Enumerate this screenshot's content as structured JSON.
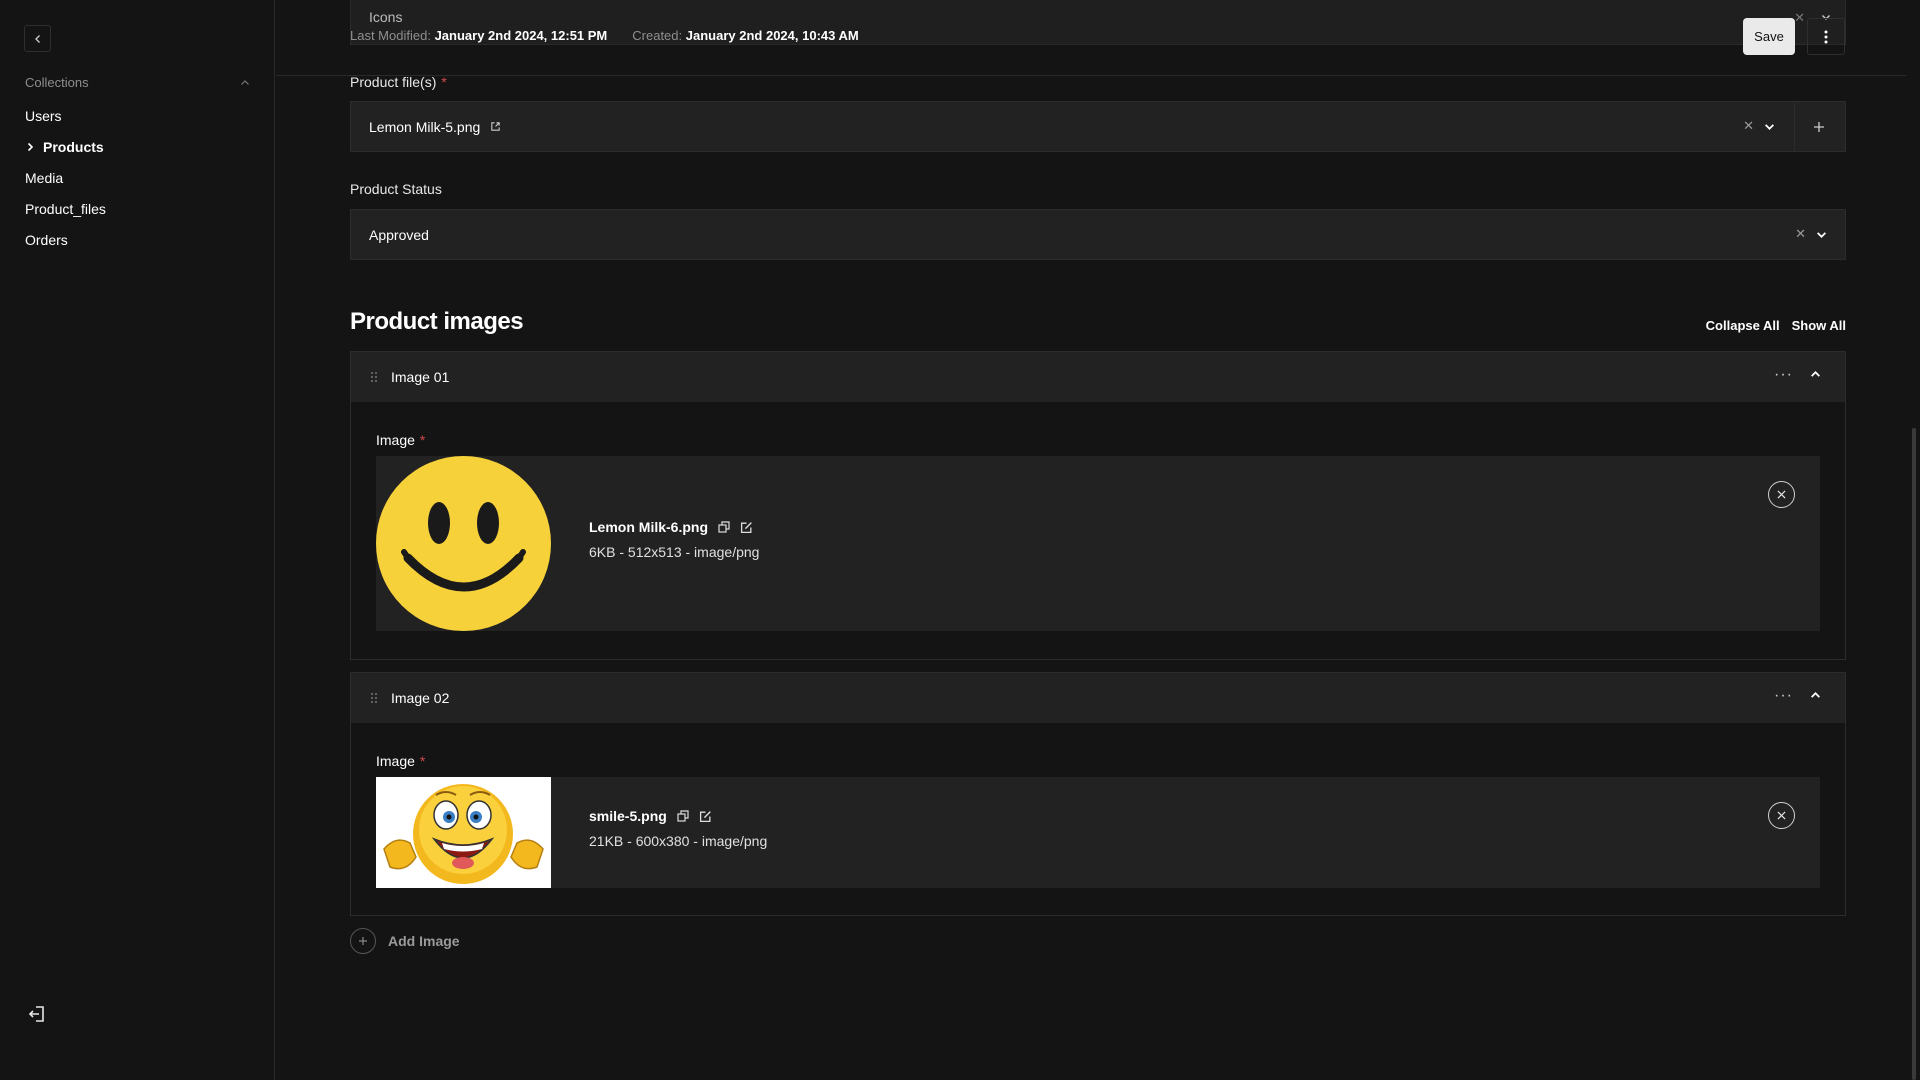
{
  "sidebar": {
    "collections_label": "Collections",
    "items": [
      {
        "label": "Users"
      },
      {
        "label": "Products"
      },
      {
        "label": "Media"
      },
      {
        "label": "Product_files"
      },
      {
        "label": "Orders"
      }
    ],
    "active_item": "Products"
  },
  "topbar": {
    "icons_field_label": "Icons",
    "last_modified_label": "Last Modified:",
    "last_modified_value": "January 2nd 2024, 12:51 PM",
    "created_label": "Created:",
    "created_value": "January 2nd 2024, 10:43 AM",
    "save_label": "Save"
  },
  "product_files": {
    "label": "Product file(s)",
    "required_mark": "*",
    "value": "Lemon Milk-5.png"
  },
  "product_status": {
    "label": "Product Status",
    "value": "Approved"
  },
  "product_images": {
    "title": "Product images",
    "collapse_all": "Collapse All",
    "show_all": "Show All",
    "blocks": [
      {
        "title": "Image 01",
        "field_label": "Image",
        "required_mark": "*",
        "file_name": "Lemon Milk-6.png",
        "file_meta": "6KB - 512x513 - image/png"
      },
      {
        "title": "Image 02",
        "field_label": "Image",
        "required_mark": "*",
        "file_name": "smile-5.png",
        "file_meta": "21KB - 600x380 - image/png"
      }
    ],
    "add_label": "Add Image"
  },
  "colors": {
    "background": "#141414",
    "panel": "#222222",
    "required": "#d44a4a",
    "save_button": "#eaeaea",
    "smiley_yellow": "#f7d139"
  }
}
